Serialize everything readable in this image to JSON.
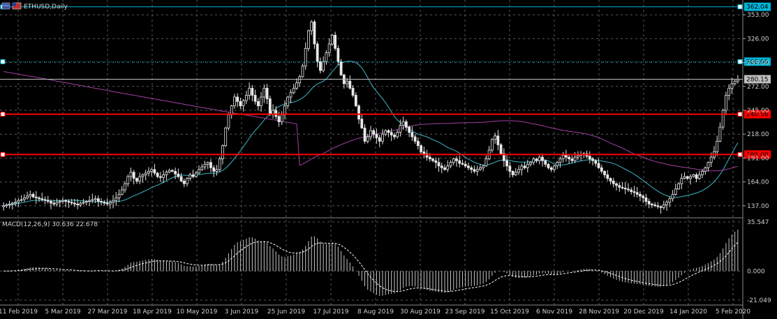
{
  "window": {
    "title": "ETHUSD,Daily",
    "icons": [
      "chart-window-icon",
      "currency-flag-icon"
    ]
  },
  "chart_data": {
    "type": "candlestick",
    "symbol": "ETHUSD",
    "timeframe": "Daily",
    "price_axis": {
      "ticks": [
        "353.00",
        "326.00",
        "299.00",
        "272.00",
        "245.00",
        "218.00",
        "191.00",
        "164.00",
        "137.00"
      ],
      "range": [
        125,
        365
      ]
    },
    "macd_axis": {
      "ticks": [
        "35.547",
        "0.000",
        "-21.049"
      ],
      "range": [
        -21.049,
        35.547
      ]
    },
    "date_labels": [
      "11 Feb 2019",
      "5 Mar 2019",
      "27 Mar 2019",
      "18 Apr 2019",
      "10 May 2019",
      "3 Jun 2019",
      "25 Jun 2019",
      "17 Jul 2019",
      "8 Aug 2019",
      "30 Aug 2019",
      "23 Sep 2019",
      "15 Oct 2019",
      "6 Nov 2019",
      "28 Nov 2019",
      "20 Dec 2019",
      "14 Jan 2020",
      "5 Feb 2020"
    ],
    "levels": [
      {
        "value": 362.04,
        "label": "362.04",
        "color": "#00b4d8",
        "style": "solid"
      },
      {
        "value": 300.0,
        "label": "300.00",
        "color": "#00b4d8",
        "style": "dotted"
      },
      {
        "value": 280.15,
        "label": "280.15",
        "color": "#c0c0c0",
        "style": "solid"
      },
      {
        "value": 240.58,
        "label": "240.58",
        "color": "#ff0000",
        "style": "solid"
      },
      {
        "value": 195.0,
        "label": "195.00",
        "color": "#ff0000",
        "style": "solid"
      }
    ],
    "indicator": {
      "label": "MACD(12,26,9) 30.636 22.678"
    },
    "closes": [
      137,
      138,
      139,
      140,
      141,
      143,
      144,
      146,
      148,
      150,
      147,
      146,
      145,
      144,
      143,
      142,
      140,
      139,
      141,
      142,
      143,
      142,
      141,
      140,
      139,
      138,
      140,
      141,
      142,
      143,
      144,
      145,
      142,
      141,
      140,
      139,
      141,
      143,
      146,
      150,
      155,
      162,
      170,
      175,
      168,
      165,
      170,
      172,
      174,
      176,
      178,
      174,
      170,
      169,
      172,
      175,
      177,
      176,
      173,
      170,
      165,
      162,
      168,
      172,
      170,
      174,
      178,
      181,
      184,
      186,
      180,
      176,
      178,
      190,
      205,
      225,
      240,
      250,
      260,
      255,
      250,
      256,
      262,
      270,
      262,
      255,
      250,
      260,
      270,
      258,
      240,
      245,
      238,
      232,
      240,
      250,
      260,
      265,
      270,
      276,
      283,
      295,
      315,
      335,
      345,
      320,
      300,
      290,
      300,
      310,
      320,
      330,
      315,
      300,
      285,
      275,
      278,
      270,
      262,
      250,
      235,
      225,
      210,
      215,
      222,
      218,
      214,
      210,
      218,
      222,
      220,
      217,
      215,
      220,
      228,
      232,
      226,
      220,
      215,
      210,
      205,
      198,
      196,
      192,
      190,
      188,
      186,
      182,
      180,
      178,
      182,
      186,
      190,
      188,
      185,
      184,
      182,
      180,
      178,
      176,
      178,
      180,
      182,
      190,
      200,
      212,
      216,
      206,
      196,
      188,
      182,
      176,
      172,
      175,
      178,
      182,
      180,
      184,
      186,
      190,
      188,
      192,
      188,
      184,
      180,
      178,
      182,
      186,
      190,
      194,
      192,
      190,
      188,
      192,
      194,
      195,
      196,
      193,
      190,
      188,
      185,
      180,
      176,
      172,
      168,
      165,
      162,
      160,
      158,
      157,
      156,
      155,
      153,
      152,
      150,
      148,
      146,
      142,
      139,
      138,
      137,
      136,
      135,
      138,
      141,
      145,
      150,
      156,
      162,
      168,
      170,
      168,
      170,
      172,
      168,
      172,
      176,
      180,
      186,
      192,
      198,
      210,
      226,
      245,
      262,
      270,
      275,
      278,
      280
    ]
  }
}
